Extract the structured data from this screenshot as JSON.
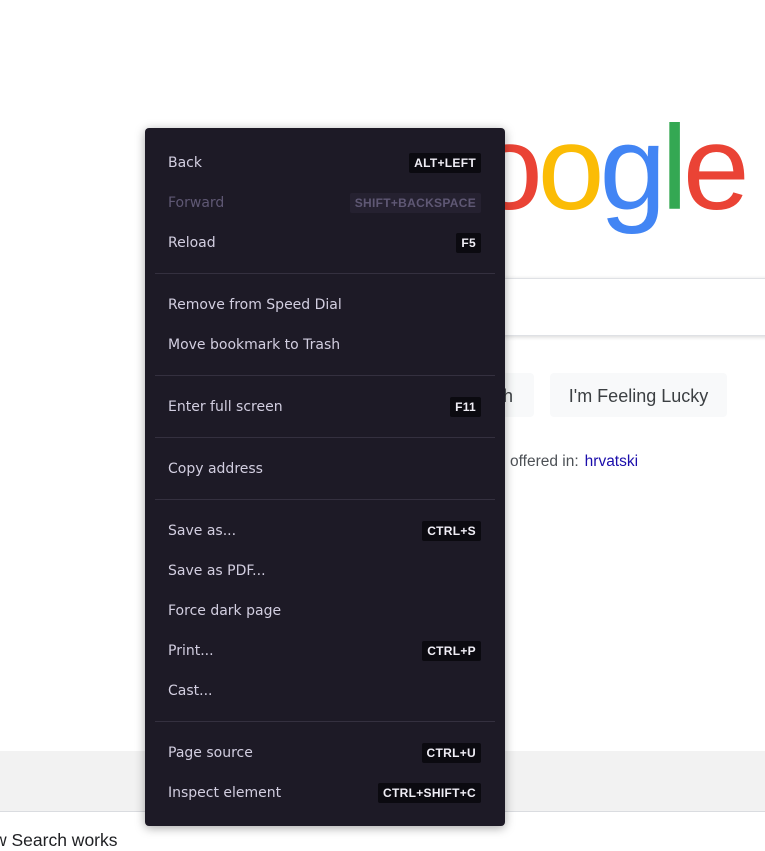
{
  "background": {
    "logo_letters": [
      {
        "char": "o",
        "color": "#ea4335"
      },
      {
        "char": "o",
        "color": "#fbbc05"
      },
      {
        "char": "g",
        "color": "#4285f4"
      },
      {
        "char": "l",
        "color": "#34a853"
      },
      {
        "char": "e",
        "color": "#ea4335"
      }
    ],
    "search_button_label": "h",
    "lucky_button_label": "I'm Feeling Lucky",
    "offered_text": "offered in:",
    "offered_language": "hrvatski",
    "footer_link": "w Search works"
  },
  "context_menu": {
    "groups": [
      [
        {
          "label": "Back",
          "shortcut": "ALT+LEFT",
          "disabled": false,
          "name": "back"
        },
        {
          "label": "Forward",
          "shortcut": "SHIFT+BACKSPACE",
          "disabled": true,
          "name": "forward"
        },
        {
          "label": "Reload",
          "shortcut": "F5",
          "disabled": false,
          "name": "reload"
        }
      ],
      [
        {
          "label": "Remove from Speed Dial",
          "shortcut": "",
          "disabled": false,
          "name": "remove-from-speed-dial"
        },
        {
          "label": "Move bookmark to Trash",
          "shortcut": "",
          "disabled": false,
          "name": "move-bookmark-to-trash"
        }
      ],
      [
        {
          "label": "Enter full screen",
          "shortcut": "F11",
          "disabled": false,
          "name": "enter-full-screen"
        }
      ],
      [
        {
          "label": "Copy address",
          "shortcut": "",
          "disabled": false,
          "name": "copy-address"
        }
      ],
      [
        {
          "label": "Save as...",
          "shortcut": "CTRL+S",
          "disabled": false,
          "name": "save-as"
        },
        {
          "label": "Save as PDF...",
          "shortcut": "",
          "disabled": false,
          "name": "save-as-pdf"
        },
        {
          "label": "Force dark page",
          "shortcut": "",
          "disabled": false,
          "name": "force-dark-page"
        },
        {
          "label": "Print...",
          "shortcut": "CTRL+P",
          "disabled": false,
          "name": "print"
        },
        {
          "label": "Cast...",
          "shortcut": "",
          "disabled": false,
          "name": "cast"
        }
      ],
      [
        {
          "label": "Page source",
          "shortcut": "CTRL+U",
          "disabled": false,
          "name": "page-source"
        },
        {
          "label": "Inspect element",
          "shortcut": "CTRL+SHIFT+C",
          "disabled": false,
          "name": "inspect-element"
        }
      ]
    ]
  }
}
